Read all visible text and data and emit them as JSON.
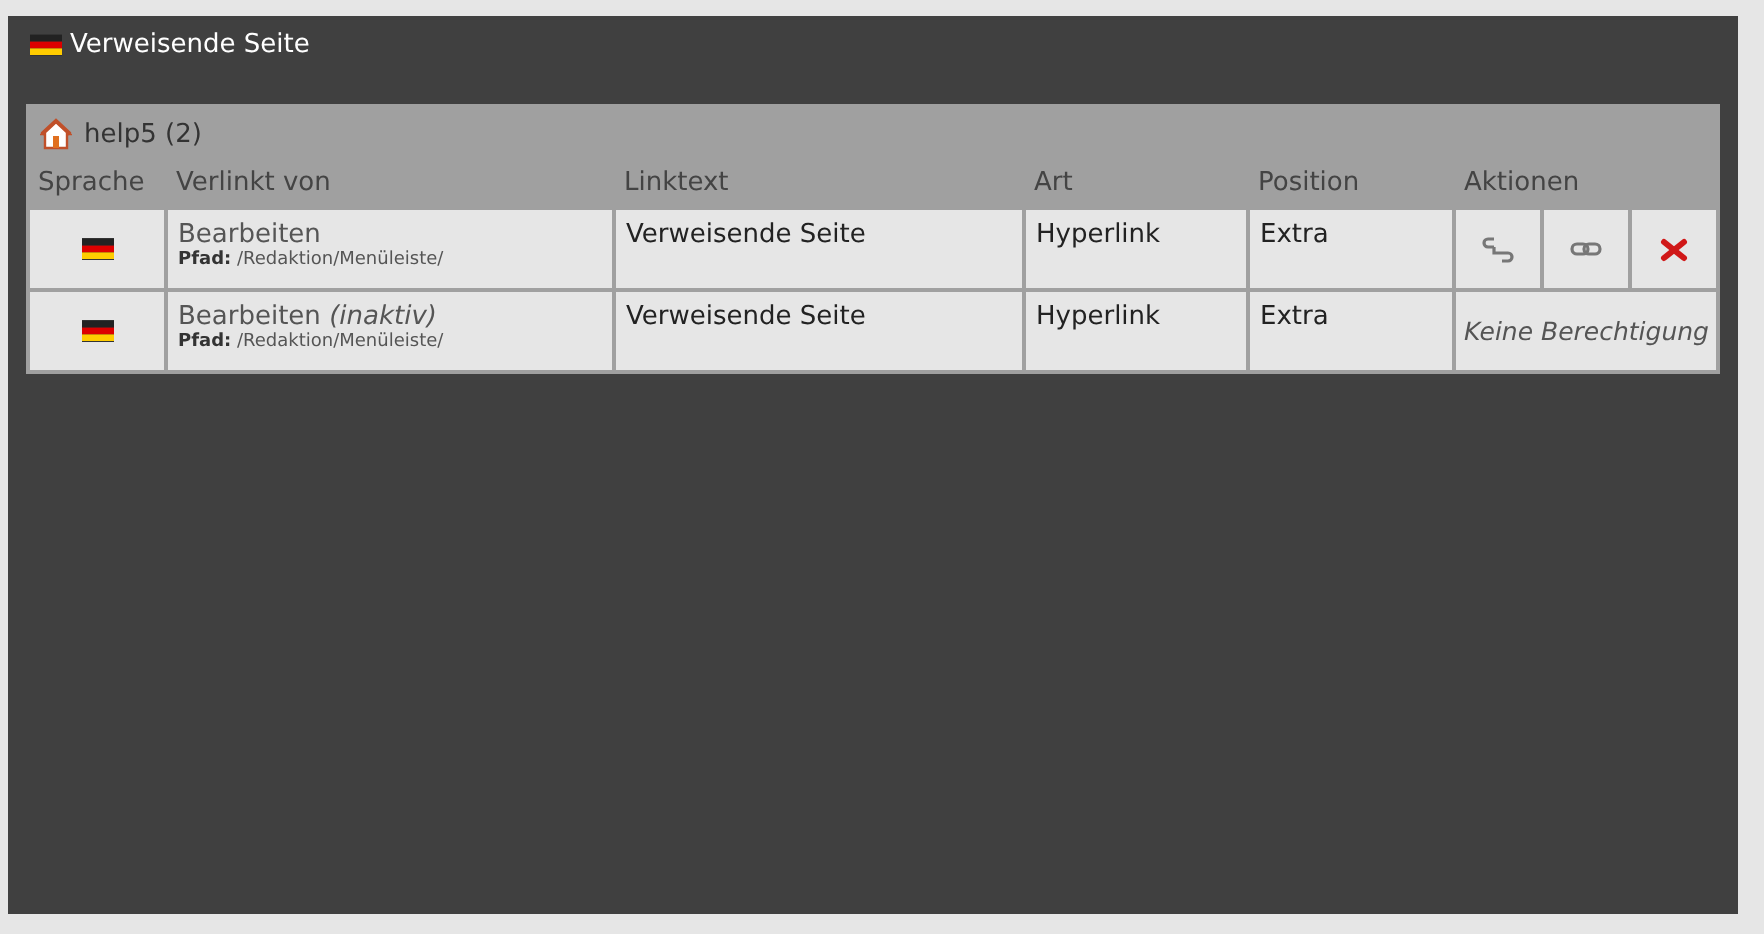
{
  "window": {
    "title": "Verweisende Seite"
  },
  "group": {
    "title": "help5 (2)"
  },
  "table": {
    "columns": [
      "Sprache",
      "Verlinkt von",
      "Linktext",
      "Art",
      "Position",
      "Aktionen"
    ],
    "rows": [
      {
        "page": "Bearbeiten",
        "path_label": "Pfad:",
        "path": "/Redaktion/Menüleiste/",
        "linktext": "Verweisende Seite",
        "type": "Hyperlink",
        "position": "Extra",
        "actions": [
          {
            "kind": "unlink"
          },
          {
            "kind": "link"
          },
          {
            "kind": "delete"
          }
        ]
      },
      {
        "page": "Bearbeiten *(inaktiv)*",
        "path_label": "Pfad:",
        "path": "/Redaktion/Menüleiste/",
        "linktext": "Verweisende Seite",
        "type": "Hyperlink",
        "position": "Extra",
        "no_permission": "Keine Berechtigung"
      }
    ]
  }
}
